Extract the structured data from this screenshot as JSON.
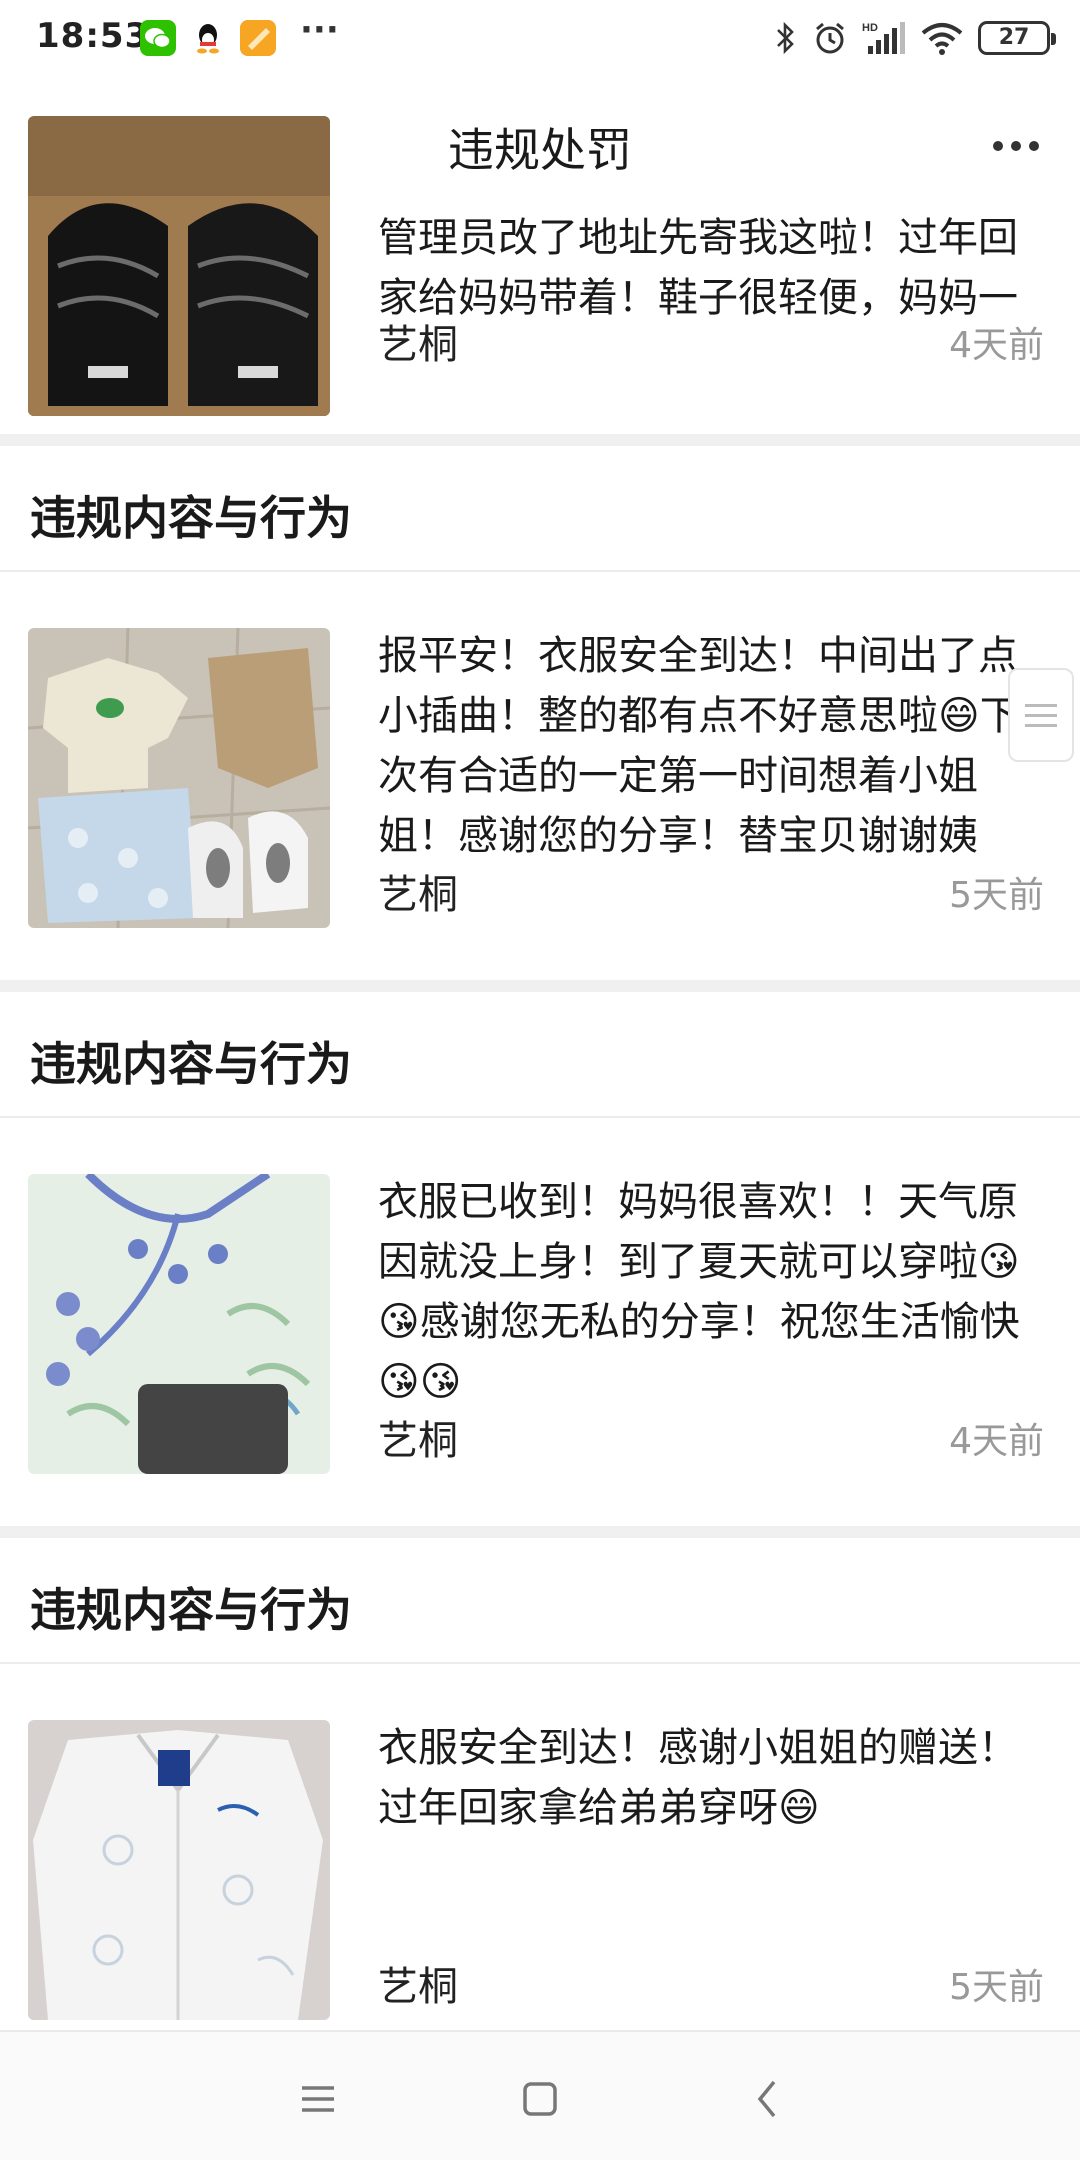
{
  "status_bar": {
    "time": "18:53",
    "more": "···",
    "battery": "27"
  },
  "nav": {
    "title": "违规处罚"
  },
  "section_title": "违规内容与行为",
  "items": [
    {
      "text": "管理员改了地址先寄我这啦！过年回家给妈妈带着！鞋子很轻便，妈妈一",
      "author": "艺桐",
      "time": "4天前",
      "image": "black-sneakers"
    },
    {
      "text": "报平安！衣服安全到达！中间出了点小插曲！整的都有点不好意思啦😄下次有合适的一定第一时间想着小姐姐！感谢您的分享！替宝贝谢谢姨",
      "author": "艺桐",
      "time": "5天前",
      "image": "kids-clothes-and-shoes"
    },
    {
      "text": "衣服已收到！妈妈很喜欢！！天气原因就没上身！到了夏天就可以穿啦😘😘感谢您无私的分享！祝您生活愉快😘😘",
      "author": "艺桐",
      "time": "4天前",
      "image": "blue-floral-top"
    },
    {
      "text": "衣服安全到达！感谢小姐姐的赠送！过年回家拿给弟弟穿呀😄",
      "author": "艺桐",
      "time": "5天前",
      "image": "white-jacket"
    }
  ],
  "colors": {
    "separator": "#f0f0f0",
    "muted_text": "#999999",
    "wechat_green": "#2dc100"
  }
}
